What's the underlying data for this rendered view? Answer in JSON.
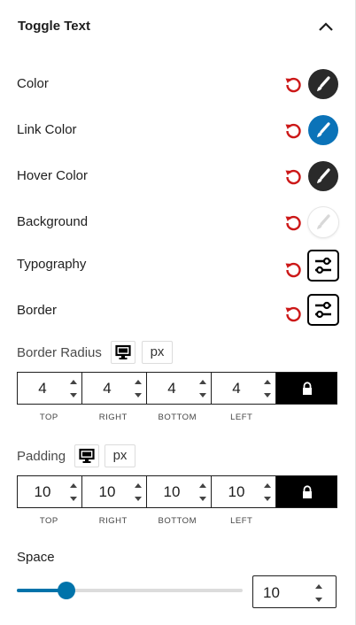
{
  "panel": {
    "title": "Toggle Text",
    "colors": {
      "reset": "#cc1818",
      "dark_swatch": "#2a2a2a",
      "link_swatch": "#0b73b8",
      "background_swatch": "#ffffff",
      "accent": "#0073aa"
    }
  },
  "color_rows": [
    {
      "label": "Color"
    },
    {
      "label": "Link Color"
    },
    {
      "label": "Hover Color"
    },
    {
      "label": "Background"
    }
  ],
  "popover_rows": [
    {
      "label": "Typography"
    },
    {
      "label": "Border"
    }
  ],
  "border_radius": {
    "label": "Border Radius",
    "unit": "px",
    "values": [
      "4",
      "4",
      "4",
      "4"
    ],
    "sides": [
      "TOP",
      "RIGHT",
      "BOTTOM",
      "LEFT"
    ]
  },
  "padding": {
    "label": "Padding",
    "unit": "px",
    "values": [
      "10",
      "10",
      "10",
      "10"
    ],
    "sides": [
      "TOP",
      "RIGHT",
      "BOTTOM",
      "LEFT"
    ]
  },
  "space": {
    "label": "Space",
    "value": "10",
    "slider_fraction": 0.22
  }
}
